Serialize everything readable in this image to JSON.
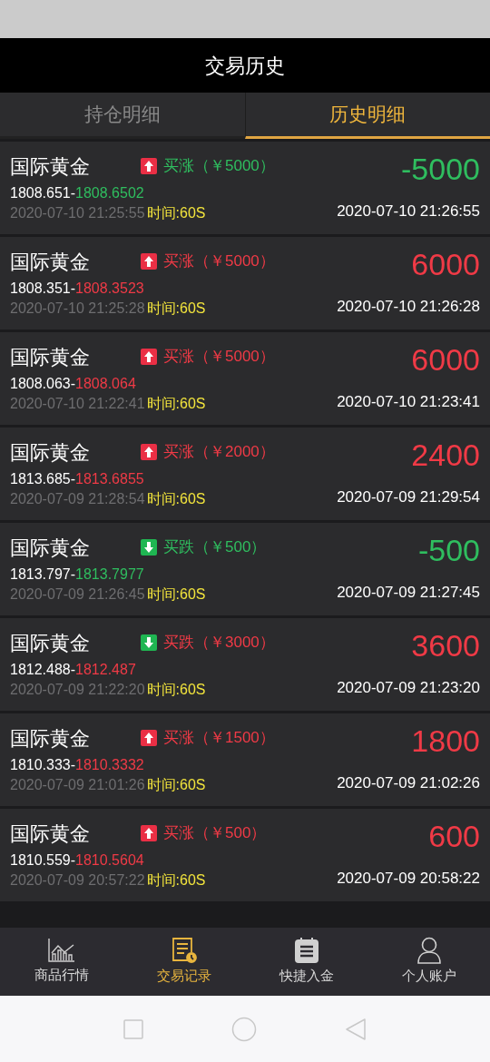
{
  "header": {
    "title": "交易历史"
  },
  "tabs": [
    {
      "label": "持仓明细",
      "selected": false
    },
    {
      "label": "历史明细",
      "selected": true
    }
  ],
  "trades": [
    {
      "name": "国际黄金",
      "rising": true,
      "bet": "买涨（￥5000）",
      "open": "1808.651-",
      "close": "1808.6502",
      "profit": false,
      "open_time": "2020-07-10 21:25:55",
      "duration": "时间:60S",
      "amount": "-5000",
      "close_time": "2020-07-10 21:26:55"
    },
    {
      "name": "国际黄金",
      "rising": true,
      "bet": "买涨（￥5000）",
      "open": "1808.351-",
      "close": "1808.3523",
      "profit": true,
      "open_time": "2020-07-10 21:25:28",
      "duration": "时间:60S",
      "amount": "6000",
      "close_time": "2020-07-10 21:26:28"
    },
    {
      "name": "国际黄金",
      "rising": true,
      "bet": "买涨（￥5000）",
      "open": "1808.063-",
      "close": "1808.064",
      "profit": true,
      "open_time": "2020-07-10 21:22:41",
      "duration": "时间:60S",
      "amount": "6000",
      "close_time": "2020-07-10 21:23:41"
    },
    {
      "name": "国际黄金",
      "rising": true,
      "bet": "买涨（￥2000）",
      "open": "1813.685-",
      "close": "1813.6855",
      "profit": true,
      "open_time": "2020-07-09 21:28:54",
      "duration": "时间:60S",
      "amount": "2400",
      "close_time": "2020-07-09 21:29:54"
    },
    {
      "name": "国际黄金",
      "rising": false,
      "bet": "买跌（￥500）",
      "open": "1813.797-",
      "close": "1813.7977",
      "profit": false,
      "open_time": "2020-07-09 21:26:45",
      "duration": "时间:60S",
      "amount": "-500",
      "close_time": "2020-07-09 21:27:45"
    },
    {
      "name": "国际黄金",
      "rising": false,
      "bet": "买跌（￥3000）",
      "open": "1812.488-",
      "close": "1812.487",
      "profit": true,
      "open_time": "2020-07-09 21:22:20",
      "duration": "时间:60S",
      "amount": "3600",
      "close_time": "2020-07-09 21:23:20"
    },
    {
      "name": "国际黄金",
      "rising": true,
      "bet": "买涨（￥1500）",
      "open": "1810.333-",
      "close": "1810.3332",
      "profit": true,
      "open_time": "2020-07-09 21:01:26",
      "duration": "时间:60S",
      "amount": "1800",
      "close_time": "2020-07-09 21:02:26"
    },
    {
      "name": "国际黄金",
      "rising": true,
      "bet": "买涨（￥500）",
      "open": "1810.559-",
      "close": "1810.5604",
      "profit": true,
      "open_time": "2020-07-09 20:57:22",
      "duration": "时间:60S",
      "amount": "600",
      "close_time": "2020-07-09 20:58:22"
    }
  ],
  "bottom_nav": [
    {
      "label": "商品行情",
      "kind": "chart",
      "selected": false
    },
    {
      "label": "交易记录",
      "kind": "records",
      "selected": true
    },
    {
      "label": "快捷入金",
      "kind": "deposit",
      "selected": false
    },
    {
      "label": "个人账户",
      "kind": "account",
      "selected": false
    }
  ]
}
